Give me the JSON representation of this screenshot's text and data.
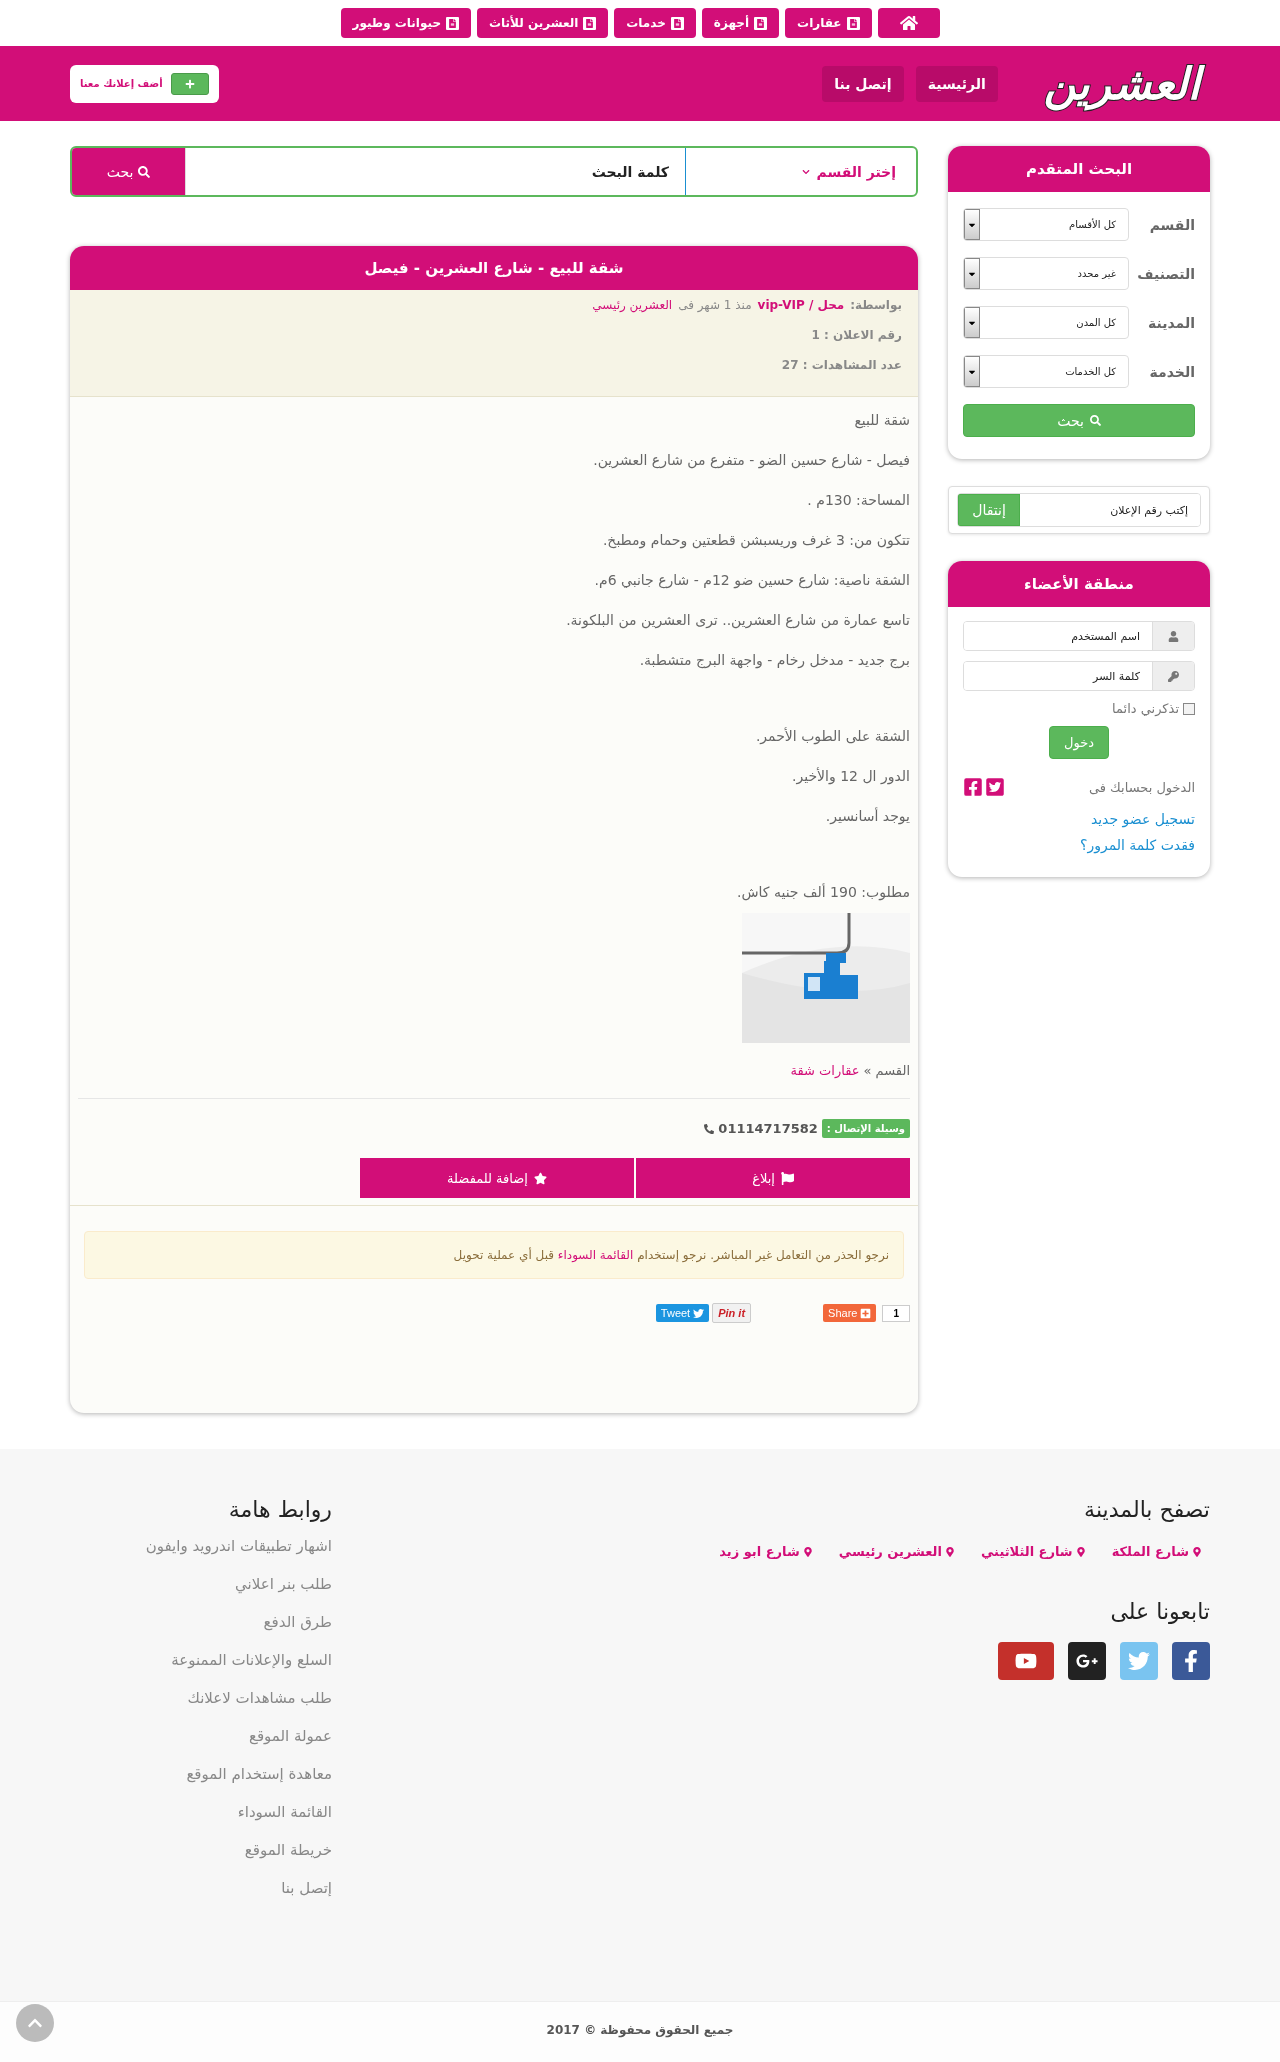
{
  "top_nav": [
    {
      "kind": "home"
    },
    {
      "kind": "category",
      "label": "عقارات"
    },
    {
      "kind": "category",
      "label": "أجهزة"
    },
    {
      "kind": "category",
      "label": "خدمات"
    },
    {
      "kind": "category",
      "label": "العشرين للأثاث"
    },
    {
      "kind": "category",
      "label": "حيوانات وطيور"
    }
  ],
  "header": {
    "logo": "العشرين",
    "nav": [
      "الرئيسية",
      "إتصل بنا"
    ],
    "add_button": "أضف إعلانك معنا"
  },
  "search": {
    "category": "إختر القسم",
    "placeholder": "كلمة البحث",
    "button": "بحث"
  },
  "listing": {
    "title": "شقة للبيع - شارع العشرين - فيصل",
    "by_label": "بواسطة:",
    "author": "محل / vip-VIP",
    "time": "منذ 1 شهر فى",
    "section": "العشرين رئيسي",
    "ad_number": "رقم الاعلان : 1",
    "views": "عدد المشاهدات : 27",
    "description_blocks": [
      [
        "شقة للبيع",
        "فيصل - شارع حسين الضو - متفرع من شارع العشرين.",
        "المساحة: 130م .",
        "تتكون من: 3 غرف وريسبشن قطعتين وحمام ومطبخ.",
        "الشقة ناصية: شارع حسين ضو 12م - شارع جانبي 6م.",
        "تاسع عمارة من شارع العشرين.. ترى العشرين من البلكونة.",
        "برج جديد - مدخل رخام - واجهة البرج متشطبة."
      ],
      [
        "الشقة على الطوب الأحمر.",
        "الدور ال 12 والأخير.",
        "يوجد أسانسير."
      ],
      [
        "مطلوب: 190 ألف جنيه كاش."
      ]
    ],
    "category_label": "القسم »",
    "category": "عقارات شقة",
    "contact_label": "وسيلة الإتصال :",
    "phone": "01114717582",
    "actions": [
      "إبلاغ",
      "إضافة للمفضلة"
    ],
    "warning": {
      "before": "نرجو الحذر من التعامل غير المباشر. نرجو إستخدام",
      "link": "القائمة السوداء",
      "after": "قبل أي عملية تحويل"
    },
    "share": {
      "tweet": "Tweet",
      "pin": "Pin it",
      "share": "Share",
      "count": "1"
    }
  },
  "advanced_search": {
    "title": "البحث المتقدم",
    "fields": [
      {
        "label": "القسم",
        "value": "كل الأقسام"
      },
      {
        "label": "التصنيف",
        "value": "غير محدد"
      },
      {
        "label": "المدينة",
        "value": "كل المدن"
      },
      {
        "label": "الخدمة",
        "value": "كل الخدمات"
      }
    ],
    "button": "بحث"
  },
  "jump": {
    "placeholder": "إكتب رقم الإعلان",
    "button": "إنتقال"
  },
  "members": {
    "title": "منطقة الأعضاء",
    "username_placeholder": "اسم المستخدم",
    "password_placeholder": "كلمة السر",
    "remember": {
      "label": "تذكرني دائما",
      "checked": false
    },
    "login": "دخول",
    "social_label": "الدخول بحسابك فى",
    "register": "تسجيل عضو جديد",
    "forgot": "فقدت كلمة المرور؟"
  },
  "footer": {
    "cities_title": "تصفح بالمدينة",
    "cities": [
      "شارع الملكة",
      "شارع الثلاثيني",
      "العشرين رئيسي",
      "شارع ابو زيد"
    ],
    "follow_title": "تابعونا على",
    "links_title": "روابط هامة",
    "links": [
      "اشهار تطبيقات اندرويد وايفون",
      "طلب بنر اعلاني",
      "طرق الدفع",
      "السلع والإعلانات الممنوعة",
      "طلب مشاهدات لاعلانك",
      "عمولة الموقع",
      "معاهدة إستخدام الموقع",
      "القائمة السوداء",
      "خريطة الموقع",
      "إتصل بنا"
    ],
    "copyright": "جميع الحقوق محفوظة © 2017"
  }
}
